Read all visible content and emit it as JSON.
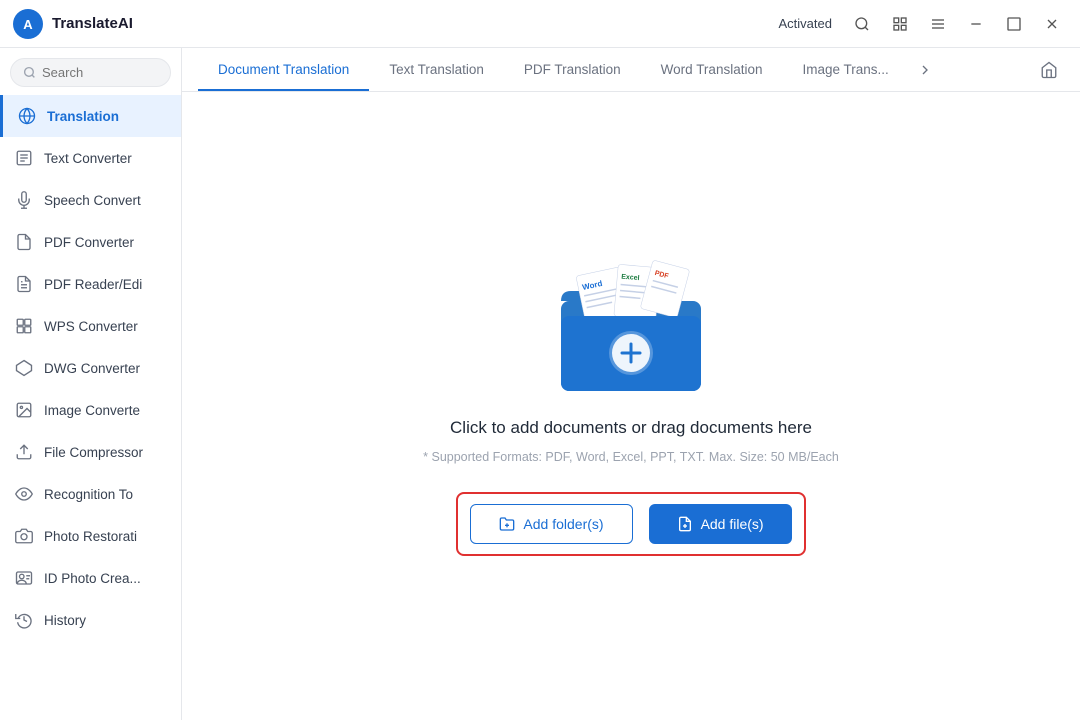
{
  "titlebar": {
    "logo_text": "TranslateAI",
    "activated_label": "Activated",
    "buttons": [
      "search",
      "expand",
      "menu",
      "minimize",
      "maximize",
      "close"
    ]
  },
  "sidebar": {
    "search_placeholder": "Search",
    "items": [
      {
        "id": "translation",
        "label": "Translation",
        "active": true
      },
      {
        "id": "text-converter",
        "label": "Text Converter",
        "active": false
      },
      {
        "id": "speech-convert",
        "label": "Speech Convert",
        "active": false
      },
      {
        "id": "pdf-converter",
        "label": "PDF Converter",
        "active": false
      },
      {
        "id": "pdf-reader",
        "label": "PDF Reader/Edi",
        "active": false
      },
      {
        "id": "wps-converter",
        "label": "WPS Converter",
        "active": false
      },
      {
        "id": "dwg-converter",
        "label": "DWG Converter",
        "active": false
      },
      {
        "id": "image-converter",
        "label": "Image Converte",
        "active": false
      },
      {
        "id": "file-compressor",
        "label": "File Compressor",
        "active": false
      },
      {
        "id": "recognition-to",
        "label": "Recognition To",
        "active": false
      },
      {
        "id": "photo-restoration",
        "label": "Photo Restorati",
        "active": false
      },
      {
        "id": "id-photo",
        "label": "ID Photo Crea...",
        "active": false
      },
      {
        "id": "history",
        "label": "History",
        "active": false
      }
    ]
  },
  "tabs": {
    "items": [
      {
        "id": "document-translation",
        "label": "Document Translation",
        "active": true
      },
      {
        "id": "text-translation",
        "label": "Text Translation",
        "active": false
      },
      {
        "id": "pdf-translation",
        "label": "PDF Translation",
        "active": false
      },
      {
        "id": "word-translation",
        "label": "Word Translation",
        "active": false
      },
      {
        "id": "image-trans",
        "label": "Image Trans...",
        "active": false
      }
    ]
  },
  "dropzone": {
    "main_text": "Click to add documents or drag documents here",
    "supported_text": "* Supported Formats: PDF, Word, Excel, PPT, TXT. Max. Size: 50 MB/Each",
    "add_folder_label": "Add folder(s)",
    "add_file_label": "Add file(s)"
  },
  "colors": {
    "accent": "#1a6ed4",
    "danger": "#e03030"
  }
}
